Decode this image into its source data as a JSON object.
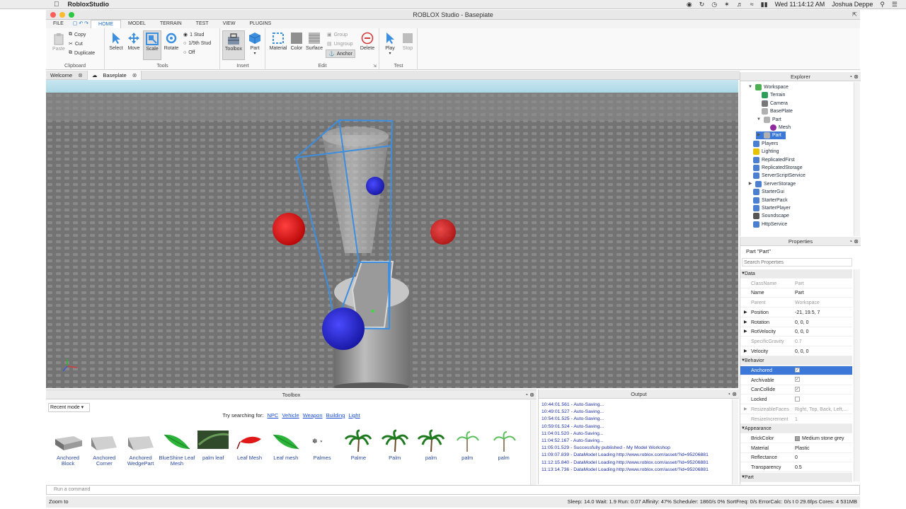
{
  "menubar": {
    "app_name": "RobloxStudio",
    "clock": "Wed 11:14:12 AM",
    "user": "Joshua Deppe"
  },
  "window": {
    "title": "ROBLOX Studio - Basepiate"
  },
  "ribbon_tabs": [
    "FILE",
    "HOME",
    "MODEL",
    "TERRAIN",
    "TEST",
    "VIEW",
    "PLUGINS"
  ],
  "ribbon": {
    "clipboard": {
      "paste": "Paste",
      "copy": "Copy",
      "cut": "Cut",
      "duplicate": "Duplicate",
      "label": "Clipboard"
    },
    "tools": {
      "select": "Select",
      "move": "Move",
      "scale": "Scale",
      "rotate": "Rotate",
      "stud1": "1 Stud",
      "stud5": "1/5th Stud",
      "off": "Off",
      "label": "Tools"
    },
    "insert": {
      "toolbox": "Toolbox",
      "part": "Part",
      "label": "Insert"
    },
    "edit": {
      "material": "Material",
      "color": "Color",
      "surface": "Surface",
      "group": "Group",
      "ungroup": "Ungroup",
      "anchor": "Anchor",
      "delete": "Delete",
      "label": "Edit"
    },
    "test": {
      "play": "Play",
      "stop": "Stop",
      "label": "Test"
    }
  },
  "doc_tabs": [
    "Welcome",
    "Baseplate"
  ],
  "explorer": {
    "title": "Explorer",
    "items": [
      {
        "label": "Workspace",
        "color": "#4caf50"
      },
      {
        "label": "Terrain",
        "color": "#2e9d5a"
      },
      {
        "label": "Camera",
        "color": "#777777"
      },
      {
        "label": "BasePlate",
        "color": "#b0b0b0"
      },
      {
        "label": "Part",
        "color": "#b0b0b0"
      },
      {
        "label": "Mesh",
        "color": "#8e2a9c"
      },
      {
        "label": "Part",
        "color": "#b0b0b0"
      },
      {
        "label": "Players",
        "color": "#4a7fd1"
      },
      {
        "label": "Lighting",
        "color": "#e6c200"
      },
      {
        "label": "ReplicatedFirst",
        "color": "#4a7fd1"
      },
      {
        "label": "ReplicatedStorage",
        "color": "#4a7fd1"
      },
      {
        "label": "ServerScriptService",
        "color": "#4a7fd1"
      },
      {
        "label": "ServerStorage",
        "color": "#4a7fd1"
      },
      {
        "label": "StarterGui",
        "color": "#4a7fd1"
      },
      {
        "label": "StarterPack",
        "color": "#4a7fd1"
      },
      {
        "label": "StarterPlayer",
        "color": "#4a7fd1"
      },
      {
        "label": "Soundscape",
        "color": "#555555"
      },
      {
        "label": "HttpService",
        "color": "#4a7fd1"
      }
    ]
  },
  "properties": {
    "title": "Properties",
    "subject": "Part \"Part\"",
    "search_placeholder": "Search Properties",
    "rows": [
      {
        "type": "cat",
        "name": "Data",
        "value": ""
      },
      {
        "type": "dim",
        "name": "ClassName",
        "value": "Part"
      },
      {
        "type": "row",
        "name": "Name",
        "value": "Part"
      },
      {
        "type": "dim",
        "name": "Parent",
        "value": "Workspace"
      },
      {
        "type": "row",
        "name": "Position",
        "value": "-21, 19.5, 7"
      },
      {
        "type": "row",
        "name": "Rotation",
        "value": "0, 0, 0"
      },
      {
        "type": "row",
        "name": "RotVelocity",
        "value": "0, 0, 0"
      },
      {
        "type": "dim",
        "name": "SpecificGravity",
        "value": "0.7"
      },
      {
        "type": "row",
        "name": "Velocity",
        "value": "0, 0, 0"
      },
      {
        "type": "cat",
        "name": "Behavior",
        "value": ""
      },
      {
        "type": "sel",
        "name": "Anchored",
        "value": "✓"
      },
      {
        "type": "row",
        "name": "Archivable",
        "value": "✓"
      },
      {
        "type": "row",
        "name": "CanCollide",
        "value": "✓"
      },
      {
        "type": "row",
        "name": "Locked",
        "value": ""
      },
      {
        "type": "dim",
        "name": "ResizeableFaces",
        "value": "Right, Top, Back, Left,..."
      },
      {
        "type": "dim",
        "name": "ResizeIncrement",
        "value": "1"
      },
      {
        "type": "cat",
        "name": "Appearance",
        "value": ""
      },
      {
        "type": "row",
        "name": "BrickColor",
        "value": "Medium stone grey"
      },
      {
        "type": "row",
        "name": "Material",
        "value": "Plastic"
      },
      {
        "type": "row",
        "name": "Reflectance",
        "value": "0"
      },
      {
        "type": "row",
        "name": "Transparency",
        "value": "0.5"
      },
      {
        "type": "cat",
        "name": "Part",
        "value": ""
      }
    ]
  },
  "toolbox": {
    "title": "Toolbox",
    "dropdown": "Recent mode",
    "try_text": "Try searching for:",
    "links": [
      "NPC",
      "Vehicle",
      "Weapon",
      "Building",
      "Light"
    ],
    "items": [
      "Anchored Block",
      "Anchored Corner",
      "Anchored WedgePart",
      "BlueShine Leaf Mesh",
      "palm leaf",
      "Leaf Mesh",
      "Leaf mesh",
      "Palmes",
      "Palme",
      "Palm",
      "palm",
      "palm",
      "palm"
    ]
  },
  "output": {
    "title": "Output",
    "lines": [
      "10:44:01.561 - Auto-Saving...",
      "10:49:01.527 - Auto-Saving...",
      "10:54:01.525 - Auto-Saving...",
      "10:59:01.524 - Auto-Saving...",
      "11:04:01.520 - Auto-Saving...",
      "11:04:52.167 - Auto-Saving...",
      "11:05:01.529 - Successfully published - My Model Workshop",
      "11:09:07.839 - DataModel Loading http://www.roblox.com/asset/?id=95206881",
      "11:12:15.840 - DataModel Loading http://www.roblox.com/asset/?id=95206881",
      "11:13:14.736 - DataModel Loading http://www.roblox.com/asset/?id=95206881"
    ]
  },
  "command_placeholder": "Run a command",
  "status": {
    "left": "Zoom to",
    "right": "Sleep: 14.0 Wait: 1.9 Run: 0.07 Affinity: 47% Scheduler: 1860/s 0% SortFreq: 0/s ErrorCalc: 0/s   t 0    29.6fps    Cores: 4    531MB"
  }
}
